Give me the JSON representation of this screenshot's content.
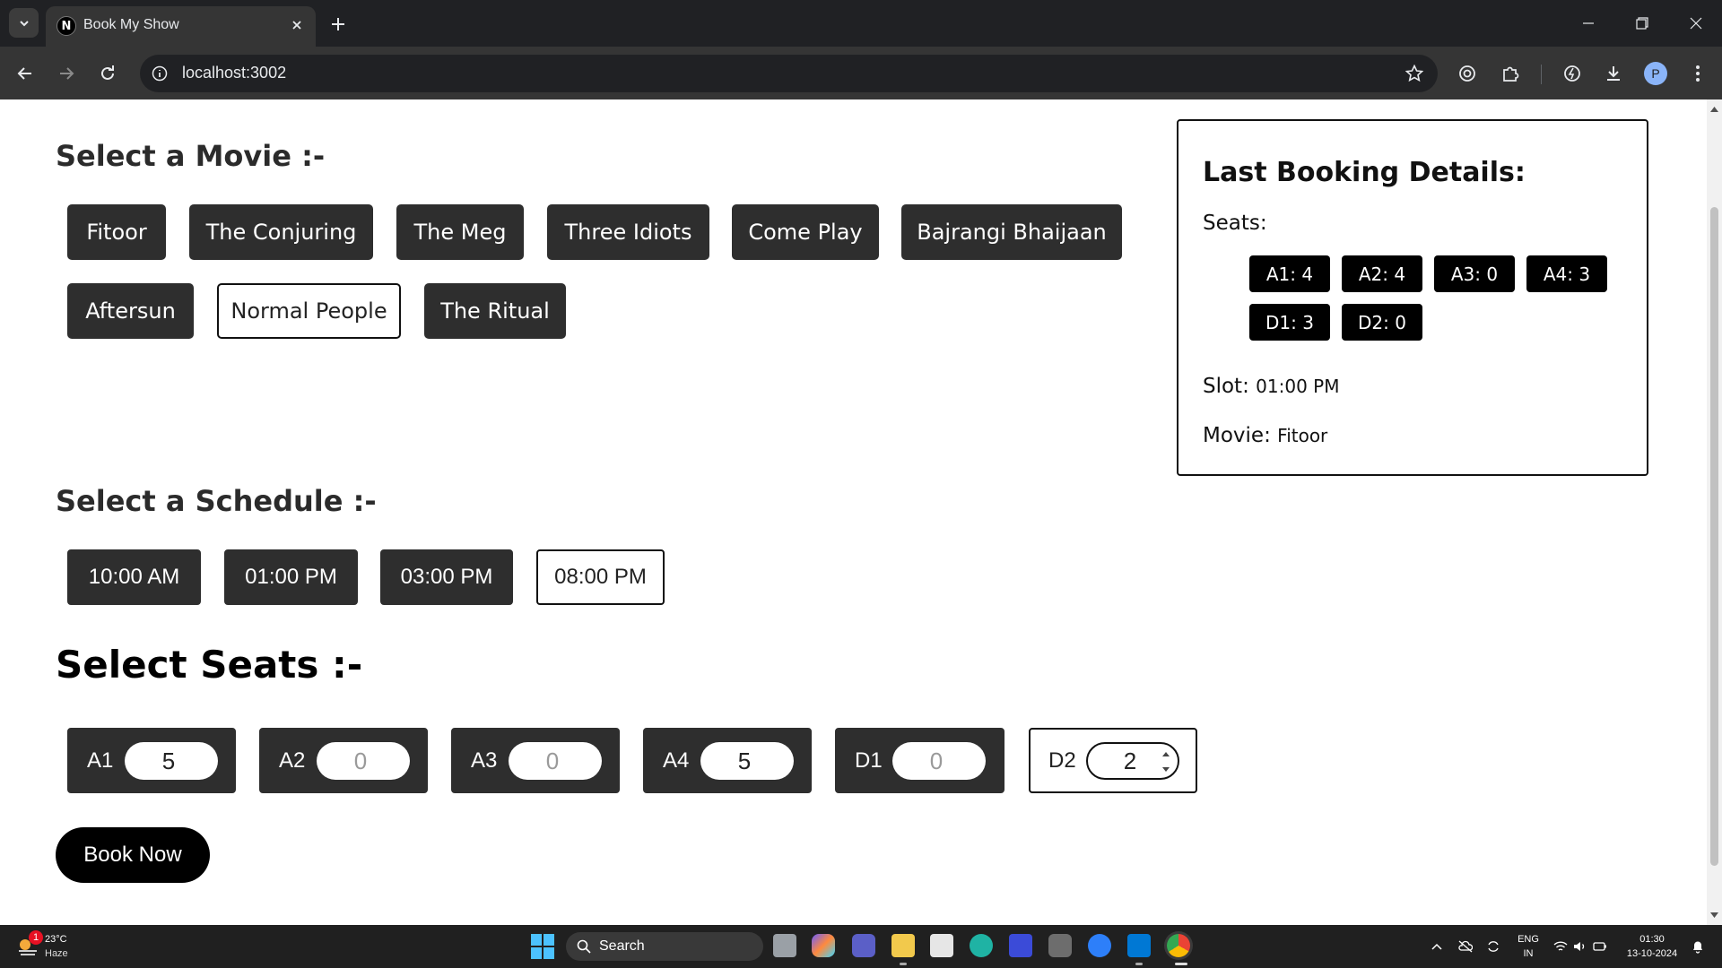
{
  "browser": {
    "tab_title": "Book My Show",
    "tab_favicon_letter": "N",
    "url": "localhost:3002",
    "profile_initial": "P"
  },
  "page": {
    "movie_heading": "Select a Movie :-",
    "movies": [
      {
        "label": "Fitoor",
        "selected": false
      },
      {
        "label": "The Conjuring",
        "selected": false
      },
      {
        "label": "The Meg",
        "selected": false
      },
      {
        "label": "Three Idiots",
        "selected": false
      },
      {
        "label": "Come Play",
        "selected": false
      },
      {
        "label": "Bajrangi Bhaijaan",
        "selected": false
      },
      {
        "label": "Aftersun",
        "selected": false
      },
      {
        "label": "Normal People",
        "selected": true
      },
      {
        "label": "The Ritual",
        "selected": false
      }
    ],
    "schedule_heading": "Select a Schedule :-",
    "schedules": [
      {
        "label": "10:00 AM",
        "selected": false
      },
      {
        "label": "01:00 PM",
        "selected": false
      },
      {
        "label": "03:00 PM",
        "selected": false
      },
      {
        "label": "08:00 PM",
        "selected": true
      }
    ],
    "seats_heading": "Select Seats :-",
    "seats": [
      {
        "label": "A1",
        "value": "5",
        "placeholder": false,
        "selected": false
      },
      {
        "label": "A2",
        "value": "0",
        "placeholder": true,
        "selected": false
      },
      {
        "label": "A3",
        "value": "0",
        "placeholder": true,
        "selected": false
      },
      {
        "label": "A4",
        "value": "5",
        "placeholder": false,
        "selected": false
      },
      {
        "label": "D1",
        "value": "0",
        "placeholder": true,
        "selected": false
      },
      {
        "label": "D2",
        "value": "2",
        "placeholder": false,
        "selected": true
      }
    ],
    "book_button": "Book Now"
  },
  "last_booking": {
    "title": "Last Booking Details:",
    "seats_label": "Seats:",
    "seat_chips": [
      "A1: 4",
      "A2: 4",
      "A3: 0",
      "A4: 3",
      "D1: 3",
      "D2: 0"
    ],
    "slot_label": "Slot:",
    "slot_value": "01:00 PM",
    "movie_label": "Movie:",
    "movie_value": "Fitoor"
  },
  "taskbar": {
    "weather_temp": "23°C",
    "weather_desc": "Haze",
    "weather_badge": "1",
    "search_label": "Search",
    "lang_line1": "ENG",
    "lang_line2": "IN",
    "time": "01:30",
    "date": "13-10-2024"
  },
  "colors": {
    "button_dark": "#2e2e2e",
    "chip_black": "#000000",
    "browser_dark": "#202124",
    "browser_toolbar": "#353535",
    "taskbar": "#202020",
    "accent_blue": "#4cc2ff"
  }
}
